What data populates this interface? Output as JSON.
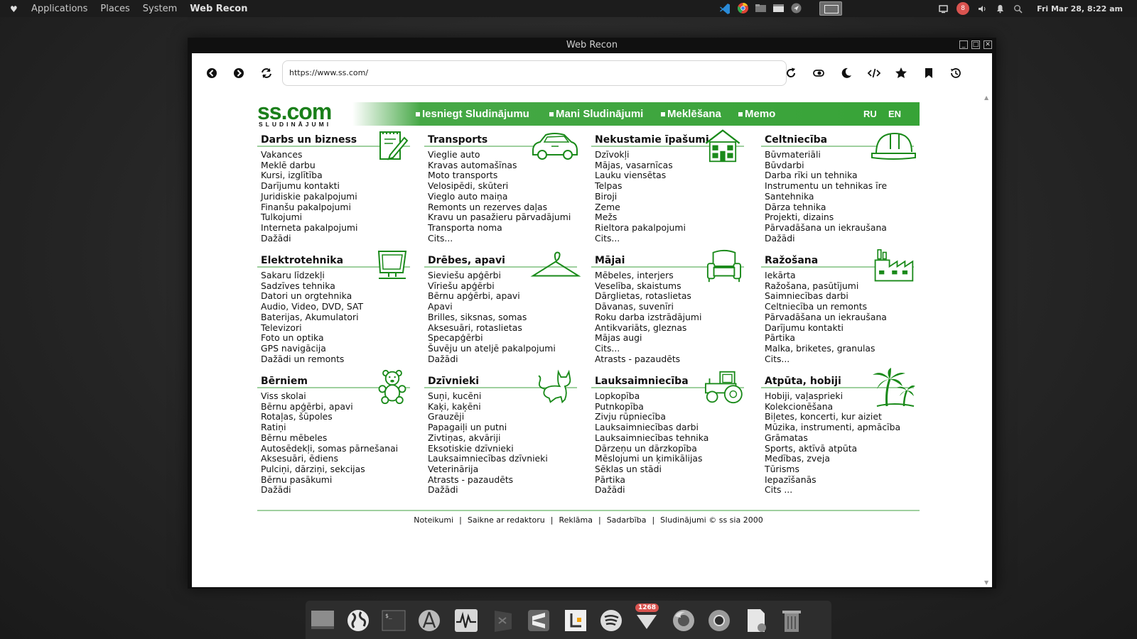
{
  "top_panel": {
    "menu": [
      "Applications",
      "Places",
      "System"
    ],
    "active_app": "Web Recon",
    "notification_count": "8",
    "clock": "Fri Mar 28,  8:22 am"
  },
  "window": {
    "title": "Web Recon"
  },
  "browser": {
    "url": "https://www.ss.com/"
  },
  "site": {
    "logo_main": "ss.com",
    "logo_sub": "SLUDINĀJUMI",
    "nav": [
      "Iesniegt Sludinājumu",
      "Mani Sludinājumi",
      "Meklēšana",
      "Memo"
    ],
    "langs": [
      "RU",
      "EN"
    ],
    "categories": [
      {
        "title": "Darbs un bizness",
        "icon": "notepad-pencil-icon",
        "items": [
          "Vakances",
          "Meklē darbu",
          "Kursi, izglītība",
          "Darījumu kontakti",
          "Juridiskie pakalpojumi",
          "Finanšu pakalpojumi",
          "Tulkojumi",
          "Interneta pakalpojumi",
          "Dažādi"
        ]
      },
      {
        "title": "Transports",
        "icon": "car-icon",
        "items": [
          "Vieglie auto",
          "Kravas automašīnas",
          "Moto transports",
          "Velosipēdi, skūteri",
          "Vieglo auto maiņa",
          "Remonts un rezerves daļas",
          "Kravu un pasažieru pārvadājumi",
          "Transporta noma",
          "Cits..."
        ]
      },
      {
        "title": "Nekustamie īpašumi",
        "icon": "house-icon",
        "items": [
          "Dzīvokļi",
          "Mājas, vasarnīcas",
          "Lauku viensētas",
          "Telpas",
          "Biroji",
          "Zeme",
          "Mežs",
          "Rieltora pakalpojumi",
          "Cits..."
        ]
      },
      {
        "title": "Celtniecība",
        "icon": "hard-hat-icon",
        "items": [
          "Būvmateriāli",
          "Būvdarbi",
          "Darba rīki un tehnika",
          "Instrumentu un tehnikas īre",
          "Santehnika",
          "Dārza tehnika",
          "Projekti, dizains",
          "Pārvadāšana un iekraušana",
          "Dažādi"
        ]
      },
      {
        "title": "Elektrotehnika",
        "icon": "monitor-icon",
        "items": [
          "Sakaru līdzekļi",
          "Sadzīves tehnika",
          "Datori un orgtehnika",
          "Audio, Video, DVD, SAT",
          "Baterijas, Akumulatori",
          "Televizori",
          "Foto un optika",
          "GPS navigācija",
          "Dažādi un remonts"
        ]
      },
      {
        "title": "Drēbes, apavi",
        "icon": "hanger-icon",
        "items": [
          "Sieviešu apģērbi",
          "Vīriešu apģērbi",
          "Bērnu apģērbi, apavi",
          "Apavi",
          "Brilles, siksnas, somas",
          "Aksesuāri, rotaslietas",
          "Specapģērbi",
          "Šuvēju un ateljē pakalpojumi",
          "Dažādi"
        ]
      },
      {
        "title": "Mājai",
        "icon": "armchair-icon",
        "items": [
          "Mēbeles, interjers",
          "Veselība, skaistums",
          "Dārglietas, rotaslietas",
          "Dāvanas, suvenīri",
          "Roku darba izstrādājumi",
          "Antikvariāts, gleznas",
          "Mājas augi",
          "Cits...",
          "Atrasts - pazaudēts"
        ]
      },
      {
        "title": "Ražošana",
        "icon": "factory-icon",
        "items": [
          "Iekārta",
          "Ražošana, pasūtījumi",
          "Saimniecības darbi",
          "Celtniecība un remonts",
          "Pārvadāšana un iekraušana",
          "Darījumu kontakti",
          "Pārtika",
          "Malka, briketes, granulas",
          "Cits..."
        ]
      },
      {
        "title": "Bērniem",
        "icon": "teddy-bear-icon",
        "items": [
          "Viss skolai",
          "Bērnu apģērbi, apavi",
          "Rotaļas, šūpoles",
          "Ratiņi",
          "Bērnu mēbeles",
          "Autosēdekļi, somas pārnešanai",
          "Aksesuāri, ēdiens",
          "Pulciņi, dārziņi, sekcijas",
          "Bērnu pasākumi",
          "Dažādi"
        ]
      },
      {
        "title": "Dzīvnieki",
        "icon": "cat-icon",
        "items": [
          "Suņi, kucēni",
          "Kaķi, kaķēni",
          "Grauzēji",
          "Papagaiļi un putni",
          "Zivtiņas, akvāriji",
          "Eksotiskie dzīvnieki",
          "Lauksaimniecības dzīvnieki",
          "Veterinārija",
          "Atrasts - pazaudēts",
          "Dažādi"
        ]
      },
      {
        "title": "Lauksaimniecība",
        "icon": "tractor-icon",
        "items": [
          "Lopkopība",
          "Putnkopība",
          "Zivju rūpniecība",
          "Lauksaimniecības darbi",
          "Lauksaimniecības tehnika",
          "Dārzeņu un dārzkopība",
          "Mēslojumi un ķimikālijas",
          "Sēklas un stādi",
          "Pārtika",
          "Dažādi"
        ]
      },
      {
        "title": "Atpūta, hobiji",
        "icon": "palm-tree-icon",
        "items": [
          "Hobiji, vaļasprieki",
          "Kolekcionēšana",
          "Biļetes, koncerti, kur aiziet",
          "Mūzika, instrumenti, apmācība",
          "Grāmatas",
          "Sports, aktīvā atpūta",
          "Medības, zveja",
          "Tūrisms",
          "Iepazīšanās",
          "Cits ..."
        ]
      }
    ],
    "footer": [
      "Noteikumi",
      "Saikne ar redaktoru",
      "Reklāma",
      "Sadarbība",
      "Sludinājumi © ss sia 2000"
    ]
  },
  "dock": {
    "mail_badge": "1268"
  },
  "colors": {
    "brand_green": "#37a337",
    "logo_green": "#1a7f1a",
    "divider_green": "#9fd09f"
  }
}
